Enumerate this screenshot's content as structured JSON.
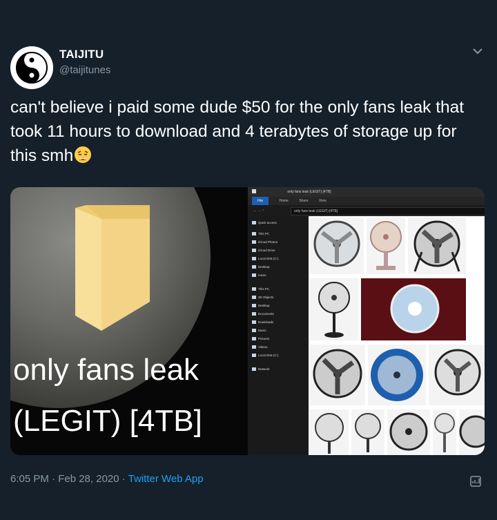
{
  "author": {
    "name": "TAIJITU",
    "handle": "@taijitunes"
  },
  "tweet": {
    "text": "can't believe i paid some dude $50 for the only fans leak that took 11 hours to download and 4 terabytes of storage up for this smh",
    "emoji": "weary-face-emoji"
  },
  "media": {
    "caption_line1": "only fans leak",
    "caption_line2": "(LEGIT) [4TB]",
    "explorer": {
      "title": "only fans leak (LEGIT) [4TB]",
      "ribbon": [
        "File",
        "Home",
        "Share",
        "View"
      ],
      "address": "only fans leak (LEGIT) [4TB]",
      "nav_items": [
        "Quick access",
        "This PC",
        "iCloud Photos",
        "iCloud Drive",
        "Local Disk (C:)",
        "Desktop",
        "music",
        "This PC",
        "3D Objects",
        "Desktop",
        "Documents",
        "Downloads",
        "Music",
        "Pictures",
        "Videos",
        "Local Disk (C:)",
        "Network"
      ]
    }
  },
  "footer": {
    "time": "6:05 PM · Feb 28, 2020 · ",
    "app": "Twitter Web App"
  },
  "colors": {
    "background": "#15202b",
    "link": "#1da1f2",
    "secondary_text": "#8899a6",
    "folder": "#f4d98c"
  }
}
